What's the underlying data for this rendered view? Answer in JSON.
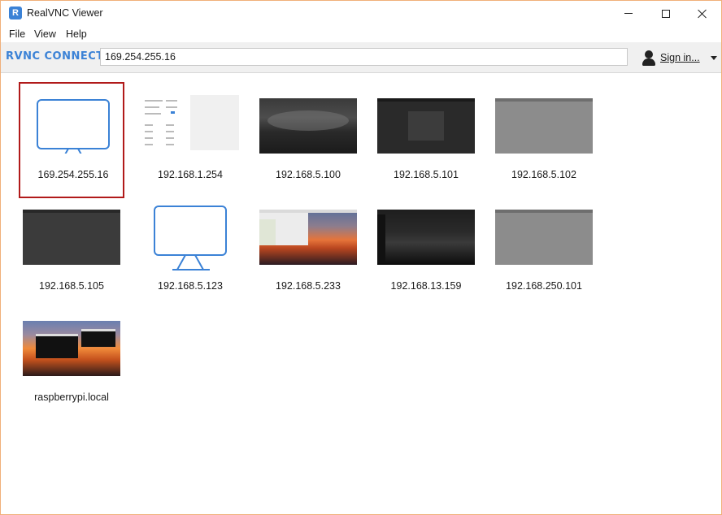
{
  "window": {
    "title": "RealVNC Viewer",
    "app_icon_glyph": "R"
  },
  "menu": {
    "file": "File",
    "view": "View",
    "help": "Help"
  },
  "toolbar": {
    "brand": "RVNC CONNECT",
    "address_value": "169.254.255.16",
    "sign_in_label": "Sign in..."
  },
  "colors": {
    "accent": "#3b82d6",
    "selection_border": "#b11a1a"
  },
  "computers": [
    {
      "label": "169.254.255.16",
      "thumbnail": "monitor-icon",
      "selected": true
    },
    {
      "label": "192.168.1.254",
      "thumbnail": "settings-form",
      "selected": false
    },
    {
      "label": "192.168.5.100",
      "thumbnail": "dark-sky-desktop",
      "selected": false
    },
    {
      "label": "192.168.5.101",
      "thumbnail": "dark-desktop-dialog",
      "selected": false
    },
    {
      "label": "192.168.5.102",
      "thumbnail": "grey-desktop",
      "selected": false
    },
    {
      "label": "192.168.5.105",
      "thumbnail": "dark-desktop",
      "selected": false
    },
    {
      "label": "192.168.5.123",
      "thumbnail": "monitor-icon",
      "selected": false
    },
    {
      "label": "192.168.5.233",
      "thumbnail": "sunset-desktop-filemanager",
      "selected": false
    },
    {
      "label": "192.168.13.159",
      "thumbnail": "night-desktop",
      "selected": false
    },
    {
      "label": "192.168.250.101",
      "thumbnail": "grey-desktop",
      "selected": false
    },
    {
      "label": "raspberrypi.local",
      "thumbnail": "sunset-desktop-terminals",
      "selected": false
    }
  ]
}
